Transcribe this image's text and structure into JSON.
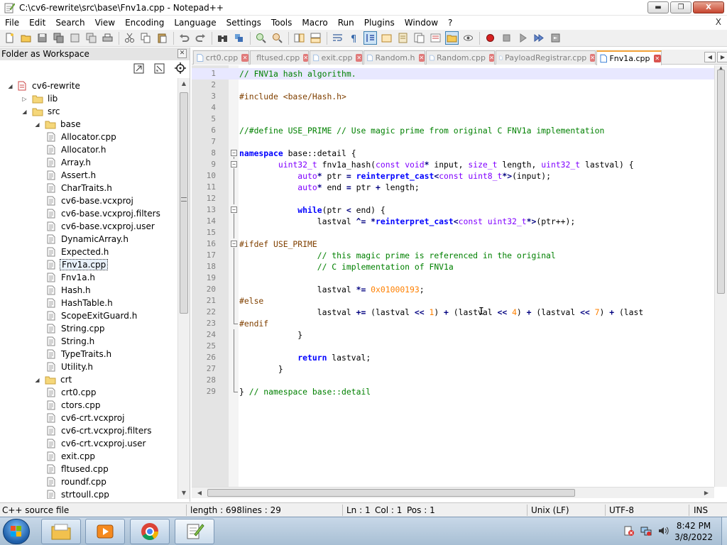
{
  "window": {
    "title": "C:\\cv6-rewrite\\src\\base\\Fnv1a.cpp - Notepad++",
    "buttons": {
      "minimize": "▬",
      "restore": "❐",
      "close": "X"
    }
  },
  "menu": {
    "items": [
      "File",
      "Edit",
      "Search",
      "View",
      "Encoding",
      "Language",
      "Settings",
      "Tools",
      "Macro",
      "Run",
      "Plugins",
      "Window",
      "?"
    ],
    "close_doc": "X"
  },
  "panel": {
    "title": "Folder as Workspace",
    "close": "✕",
    "tree": [
      {
        "label": "cv6-rewrite",
        "level": 0,
        "kind": "root",
        "expanded": true
      },
      {
        "label": "lib",
        "level": 1,
        "kind": "folder",
        "expanded": false
      },
      {
        "label": "src",
        "level": 1,
        "kind": "folder",
        "expanded": true
      },
      {
        "label": "base",
        "level": 2,
        "kind": "folder",
        "expanded": true
      },
      {
        "label": "Allocator.cpp",
        "level": 3,
        "kind": "file"
      },
      {
        "label": "Allocator.h",
        "level": 3,
        "kind": "file"
      },
      {
        "label": "Array.h",
        "level": 3,
        "kind": "file"
      },
      {
        "label": "Assert.h",
        "level": 3,
        "kind": "file"
      },
      {
        "label": "CharTraits.h",
        "level": 3,
        "kind": "file"
      },
      {
        "label": "cv6-base.vcxproj",
        "level": 3,
        "kind": "file"
      },
      {
        "label": "cv6-base.vcxproj.filters",
        "level": 3,
        "kind": "file"
      },
      {
        "label": "cv6-base.vcxproj.user",
        "level": 3,
        "kind": "file"
      },
      {
        "label": "DynamicArray.h",
        "level": 3,
        "kind": "file"
      },
      {
        "label": "Expected.h",
        "level": 3,
        "kind": "file"
      },
      {
        "label": "Fnv1a.cpp",
        "level": 3,
        "kind": "file",
        "selected": true
      },
      {
        "label": "Fnv1a.h",
        "level": 3,
        "kind": "file"
      },
      {
        "label": "Hash.h",
        "level": 3,
        "kind": "file"
      },
      {
        "label": "HashTable.h",
        "level": 3,
        "kind": "file"
      },
      {
        "label": "ScopeExitGuard.h",
        "level": 3,
        "kind": "file"
      },
      {
        "label": "String.cpp",
        "level": 3,
        "kind": "file"
      },
      {
        "label": "String.h",
        "level": 3,
        "kind": "file"
      },
      {
        "label": "TypeTraits.h",
        "level": 3,
        "kind": "file"
      },
      {
        "label": "Utility.h",
        "level": 3,
        "kind": "file"
      },
      {
        "label": "crt",
        "level": 2,
        "kind": "folder",
        "expanded": true
      },
      {
        "label": "crt0.cpp",
        "level": 3,
        "kind": "file"
      },
      {
        "label": "ctors.cpp",
        "level": 3,
        "kind": "file"
      },
      {
        "label": "cv6-crt.vcxproj",
        "level": 3,
        "kind": "file"
      },
      {
        "label": "cv6-crt.vcxproj.filters",
        "level": 3,
        "kind": "file"
      },
      {
        "label": "cv6-crt.vcxproj.user",
        "level": 3,
        "kind": "file"
      },
      {
        "label": "exit.cpp",
        "level": 3,
        "kind": "file"
      },
      {
        "label": "fltused.cpp",
        "level": 3,
        "kind": "file"
      },
      {
        "label": "roundf.cpp",
        "level": 3,
        "kind": "file"
      },
      {
        "label": "strtoull.cpp",
        "level": 3,
        "kind": "file"
      }
    ]
  },
  "tabs": [
    {
      "label": "crt0.cpp",
      "active": false
    },
    {
      "label": "fltused.cpp",
      "active": false
    },
    {
      "label": "exit.cpp",
      "active": false
    },
    {
      "label": "Random.h",
      "active": false
    },
    {
      "label": "Random.cpp",
      "active": false
    },
    {
      "label": "PayloadRegistrar.cpp",
      "active": false
    },
    {
      "label": "Fnv1a.cpp",
      "active": true
    }
  ],
  "editor": {
    "lines": [
      {
        "n": "1",
        "fold": "",
        "code": [
          [
            "com",
            "// FNV1a hash algorithm."
          ]
        ]
      },
      {
        "n": "2",
        "fold": "",
        "code": []
      },
      {
        "n": "3",
        "fold": "",
        "code": [
          [
            "pre",
            "#include <base/Hash.h>"
          ]
        ]
      },
      {
        "n": "4",
        "fold": "",
        "code": []
      },
      {
        "n": "5",
        "fold": "",
        "code": []
      },
      {
        "n": "6",
        "fold": "",
        "code": [
          [
            "com",
            "//#define USE_PRIME // Use magic prime from original C FNV1a implementation"
          ]
        ]
      },
      {
        "n": "7",
        "fold": "",
        "code": []
      },
      {
        "n": "8",
        "fold": "box",
        "code": [
          [
            "kw",
            "namespace"
          ],
          [
            "nm",
            " base::detail {"
          ]
        ]
      },
      {
        "n": "9",
        "fold": "box",
        "code": [
          [
            "nm",
            "        "
          ],
          [
            "type",
            "uint32_t"
          ],
          [
            "nm",
            " fnv1a_hash("
          ],
          [
            "type",
            "const void"
          ],
          [
            "op",
            "*"
          ],
          [
            "nm",
            " input, "
          ],
          [
            "type",
            "size_t"
          ],
          [
            "nm",
            " length, "
          ],
          [
            "type",
            "uint32_t"
          ],
          [
            "nm",
            " lastval) {"
          ]
        ]
      },
      {
        "n": "10",
        "fold": "line",
        "code": [
          [
            "nm",
            "            "
          ],
          [
            "type",
            "auto"
          ],
          [
            "op",
            "*"
          ],
          [
            "nm",
            " ptr "
          ],
          [
            "op",
            "="
          ],
          [
            "nm",
            " "
          ],
          [
            "kw",
            "reinterpret_cast"
          ],
          [
            "op",
            "<"
          ],
          [
            "type",
            "const uint8_t"
          ],
          [
            "op",
            "*>"
          ],
          [
            "nm",
            "(input);"
          ]
        ]
      },
      {
        "n": "11",
        "fold": "line",
        "code": [
          [
            "nm",
            "            "
          ],
          [
            "type",
            "auto"
          ],
          [
            "op",
            "*"
          ],
          [
            "nm",
            " end "
          ],
          [
            "op",
            "="
          ],
          [
            "nm",
            " ptr "
          ],
          [
            "op",
            "+"
          ],
          [
            "nm",
            " length;"
          ]
        ]
      },
      {
        "n": "12",
        "fold": "line",
        "code": []
      },
      {
        "n": "13",
        "fold": "box",
        "code": [
          [
            "nm",
            "            "
          ],
          [
            "kw",
            "while"
          ],
          [
            "nm",
            "(ptr "
          ],
          [
            "op",
            "<"
          ],
          [
            "nm",
            " end) {"
          ]
        ]
      },
      {
        "n": "14",
        "fold": "line",
        "code": [
          [
            "nm",
            "                lastval "
          ],
          [
            "op",
            "^="
          ],
          [
            "nm",
            " "
          ],
          [
            "op",
            "*"
          ],
          [
            "kw",
            "reinterpret_cast"
          ],
          [
            "op",
            "<"
          ],
          [
            "type",
            "const uint32_t"
          ],
          [
            "op",
            "*>"
          ],
          [
            "nm",
            "(ptr++);"
          ]
        ]
      },
      {
        "n": "15",
        "fold": "line",
        "code": []
      },
      {
        "n": "16",
        "fold": "box",
        "code": [
          [
            "pre",
            "#ifdef USE_PRIME"
          ]
        ]
      },
      {
        "n": "17",
        "fold": "line",
        "code": [
          [
            "nm",
            "                "
          ],
          [
            "com",
            "// this magic prime is referenced in the original"
          ]
        ]
      },
      {
        "n": "18",
        "fold": "line",
        "code": [
          [
            "nm",
            "                "
          ],
          [
            "com",
            "// C implementation of FNV1a"
          ]
        ]
      },
      {
        "n": "19",
        "fold": "line",
        "code": []
      },
      {
        "n": "20",
        "fold": "line",
        "code": [
          [
            "nm",
            "                lastval "
          ],
          [
            "op",
            "*="
          ],
          [
            "nm",
            " "
          ],
          [
            "num",
            "0x01000193"
          ],
          [
            "nm",
            ";"
          ]
        ]
      },
      {
        "n": "21",
        "fold": "line",
        "code": [
          [
            "pre",
            "#else"
          ]
        ]
      },
      {
        "n": "22",
        "fold": "line",
        "code": [
          [
            "nm",
            "                lastval "
          ],
          [
            "op",
            "+="
          ],
          [
            "nm",
            " (lastval "
          ],
          [
            "op",
            "<<"
          ],
          [
            "nm",
            " "
          ],
          [
            "num",
            "1"
          ],
          [
            "nm",
            ") "
          ],
          [
            "op",
            "+"
          ],
          [
            "nm",
            " (lastval "
          ],
          [
            "op",
            "<<"
          ],
          [
            "nm",
            " "
          ],
          [
            "num",
            "4"
          ],
          [
            "nm",
            ") "
          ],
          [
            "op",
            "+"
          ],
          [
            "nm",
            " (lastval "
          ],
          [
            "op",
            "<<"
          ],
          [
            "nm",
            " "
          ],
          [
            "num",
            "7"
          ],
          [
            "nm",
            ") "
          ],
          [
            "op",
            "+"
          ],
          [
            "nm",
            " (last"
          ]
        ]
      },
      {
        "n": "23",
        "fold": "end",
        "code": [
          [
            "pre",
            "#endif"
          ]
        ]
      },
      {
        "n": "24",
        "fold": "line",
        "code": [
          [
            "nm",
            "            }"
          ]
        ]
      },
      {
        "n": "25",
        "fold": "line",
        "code": []
      },
      {
        "n": "26",
        "fold": "line",
        "code": [
          [
            "nm",
            "            "
          ],
          [
            "kw",
            "return"
          ],
          [
            "nm",
            " lastval;"
          ]
        ]
      },
      {
        "n": "27",
        "fold": "line",
        "code": [
          [
            "nm",
            "        }"
          ]
        ]
      },
      {
        "n": "28",
        "fold": "line",
        "code": []
      },
      {
        "n": "29",
        "fold": "end",
        "code": [
          [
            "nm",
            "} "
          ],
          [
            "com",
            "// namespace base::detail"
          ]
        ]
      }
    ]
  },
  "status": {
    "file_type": "C++ source file",
    "length": "length : 698",
    "lines": "lines : 29",
    "ln": "Ln : 1",
    "col": "Col : 1",
    "pos": "Pos : 1",
    "eol": "Unix (LF)",
    "encoding": "UTF-8",
    "mode": "INS"
  },
  "taskbar": {
    "time": "8:42 PM",
    "date": "3/8/2022"
  }
}
